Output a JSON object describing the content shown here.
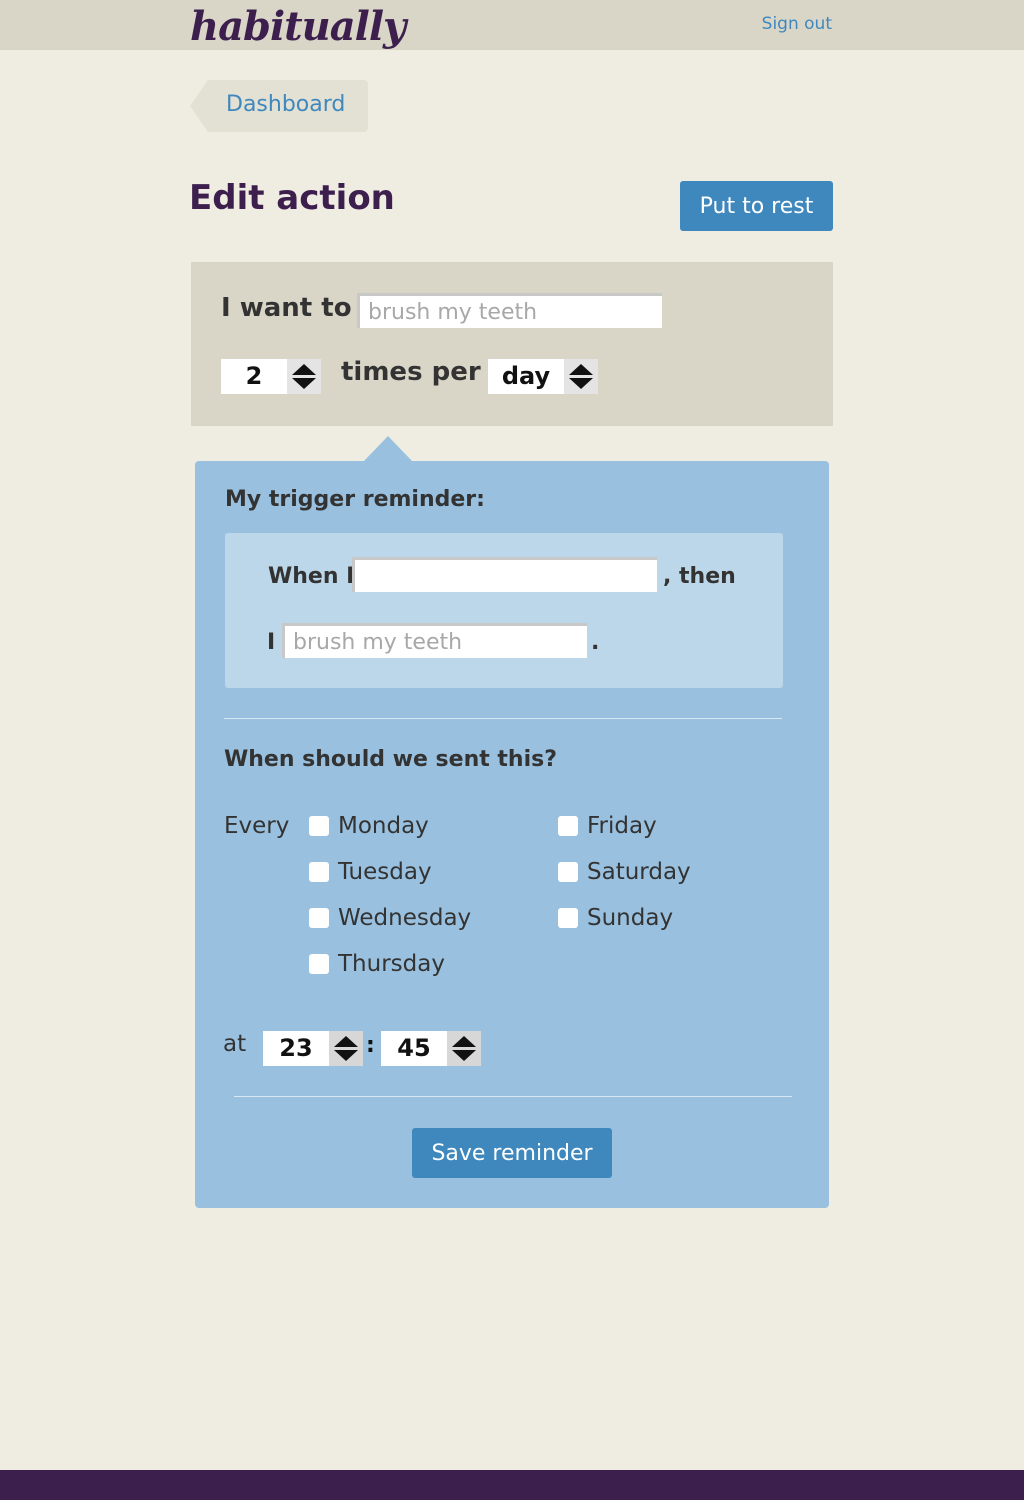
{
  "header": {
    "logo": "habitually",
    "signout_label": "Sign out"
  },
  "breadcrumb": {
    "label": "Dashboard"
  },
  "page": {
    "title": "Edit action",
    "put_to_rest_label": "Put to rest"
  },
  "action": {
    "want_label": "I want to",
    "want_placeholder": "brush my teeth",
    "want_value": "",
    "frequency_value": "2",
    "times_per_label": "times per",
    "period_value": "day"
  },
  "trigger": {
    "title": "My trigger reminder:",
    "when_label": "When I",
    "when_value": "",
    "then_label": ", then",
    "i_label": "I",
    "i_placeholder": "brush my teeth",
    "period_label": "."
  },
  "schedule": {
    "title": "When should we sent this?",
    "every_label": "Every",
    "days": [
      {
        "name": "Monday",
        "checked": false
      },
      {
        "name": "Tuesday",
        "checked": false
      },
      {
        "name": "Wednesday",
        "checked": false
      },
      {
        "name": "Thursday",
        "checked": false
      },
      {
        "name": "Friday",
        "checked": false
      },
      {
        "name": "Saturday",
        "checked": false
      },
      {
        "name": "Sunday",
        "checked": false
      }
    ],
    "at_label": "at",
    "hour": "23",
    "colon": ":",
    "minute": "45",
    "save_label": "Save reminder"
  },
  "colors": {
    "brand_purple": "#3d1f4e",
    "accent_blue": "#3f88bd",
    "background": "#efede2",
    "panel_tan": "#d9d6c7",
    "panel_blue": "#99c1df",
    "panel_blue_inner": "#bcd7ea"
  }
}
